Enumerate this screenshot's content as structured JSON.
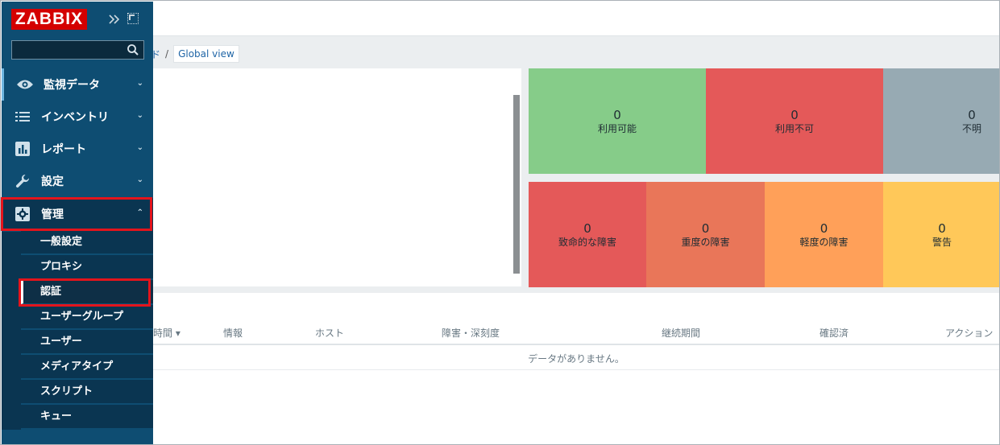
{
  "brand": {
    "logo_text": "ZABBIX",
    "logo_color": "#d40000",
    "sidebar_color": "#0e4d72"
  },
  "sidebar": {
    "collapse_icon": "double-chevron-right-icon",
    "kiosk_icon": "kiosk-mode-icon",
    "search": {
      "placeholder": "",
      "value": "",
      "icon": "search-icon"
    },
    "menu": [
      {
        "label": "監視データ",
        "icon": "eye-icon",
        "expanded": false
      },
      {
        "label": "インベントリ",
        "icon": "list-icon",
        "expanded": false
      },
      {
        "label": "レポート",
        "icon": "bar-chart-icon",
        "expanded": false
      },
      {
        "label": "設定",
        "icon": "wrench-icon",
        "expanded": false
      },
      {
        "label": "管理",
        "icon": "gear-icon",
        "expanded": true
      }
    ],
    "admin_submenu": [
      {
        "label": "一般設定"
      },
      {
        "label": "プロキシ"
      },
      {
        "label": "認証",
        "current": true
      },
      {
        "label": "ユーザーグループ"
      },
      {
        "label": "ユーザー"
      },
      {
        "label": "メディアタイプ"
      },
      {
        "label": "スクリプト"
      },
      {
        "label": "キュー"
      }
    ]
  },
  "breadcrumb": {
    "partial": "ド",
    "separator": "/",
    "current": "Global view"
  },
  "host_availability": [
    {
      "count": "0",
      "label": "利用可能",
      "color": "#86cc89"
    },
    {
      "count": "0",
      "label": "利用不可",
      "color": "#e45959"
    },
    {
      "count": "0",
      "label": "不明",
      "color": "#97aab3"
    }
  ],
  "problems_by_severity": [
    {
      "count": "0",
      "label": "致命的な障害",
      "color": "#e45959"
    },
    {
      "count": "0",
      "label": "重度の障害",
      "color": "#e97659"
    },
    {
      "count": "0",
      "label": "軽度の障害",
      "color": "#ffa059"
    },
    {
      "count": "0",
      "label": "警告",
      "color": "#ffc859"
    }
  ],
  "problems_table": {
    "columns": [
      "時間 ▾",
      "情報",
      "ホスト",
      "障害・深刻度",
      "継続期間",
      "確認済",
      "アクション"
    ],
    "empty_message": "データがありません。"
  },
  "highlight_color": "#e3141c"
}
